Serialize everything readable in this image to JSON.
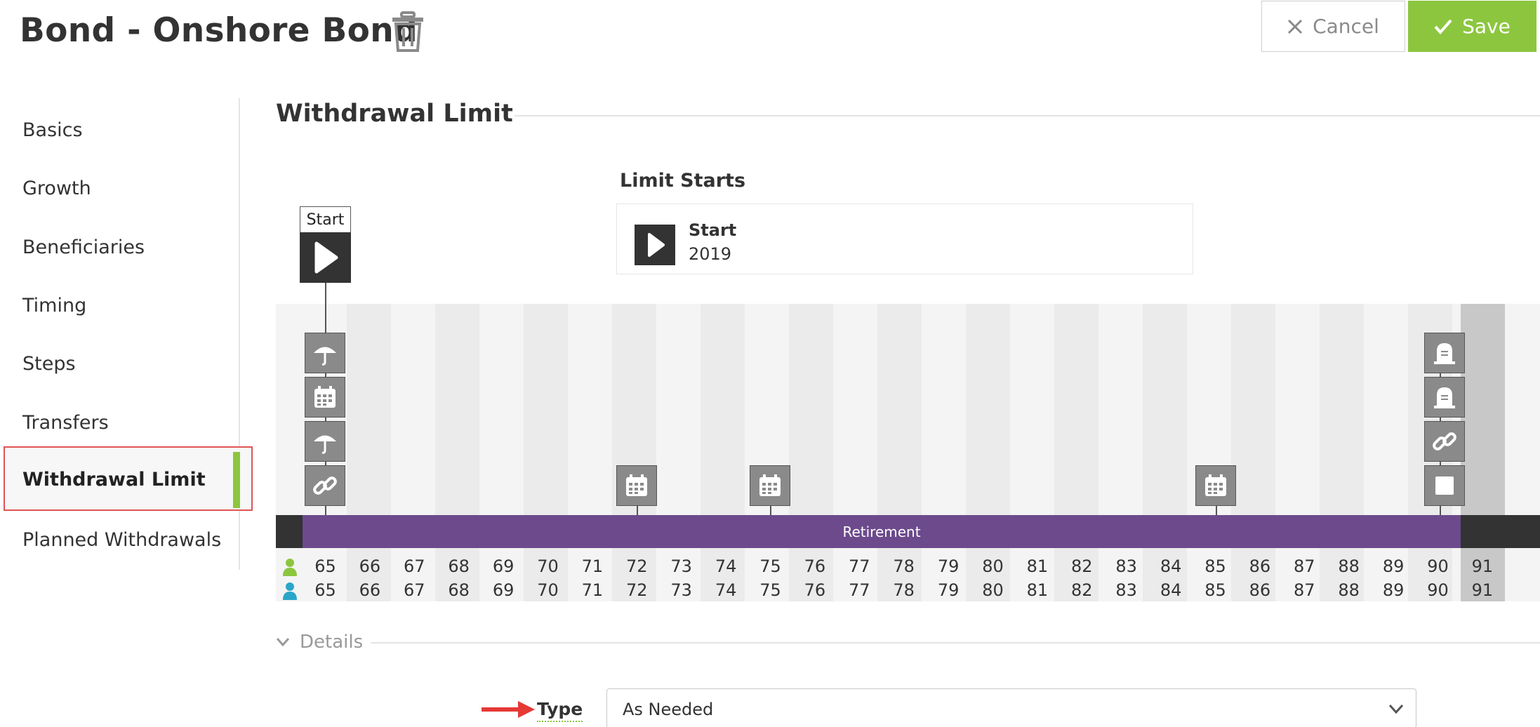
{
  "header": {
    "title": "Bond - Onshore Bond",
    "cancel_label": "Cancel",
    "save_label": "Save"
  },
  "sidebar": {
    "items": [
      {
        "label": "Basics"
      },
      {
        "label": "Growth"
      },
      {
        "label": "Beneficiaries"
      },
      {
        "label": "Timing"
      },
      {
        "label": "Steps"
      },
      {
        "label": "Transfers"
      },
      {
        "label": "Withdrawal Limit",
        "active": true
      },
      {
        "label": "Planned Withdrawals"
      }
    ]
  },
  "main": {
    "section_title": "Withdrawal Limit",
    "limit_starts": {
      "title": "Limit Starts",
      "event_name": "Start",
      "event_year": "2019"
    },
    "timeline": {
      "start_marker_label": "Start",
      "band_label": "Retirement",
      "ages_person1": [
        "65",
        "66",
        "67",
        "68",
        "69",
        "70",
        "71",
        "72",
        "73",
        "74",
        "75",
        "76",
        "77",
        "78",
        "79",
        "80",
        "81",
        "82",
        "83",
        "84",
        "85",
        "86",
        "87",
        "88",
        "89",
        "90",
        "91"
      ],
      "ages_person2": [
        "65",
        "66",
        "67",
        "68",
        "69",
        "70",
        "71",
        "72",
        "73",
        "74",
        "75",
        "76",
        "77",
        "78",
        "79",
        "80",
        "81",
        "82",
        "83",
        "84",
        "85",
        "86",
        "87",
        "88",
        "89",
        "90",
        "91"
      ],
      "person1_color": "#8cc63f",
      "person2_color": "#2aa6c9",
      "band_color": "#6c4a8c"
    },
    "details_label": "Details",
    "type_label": "Type",
    "type_value": "As Needed"
  },
  "colors": {
    "accent_green": "#8cc63f",
    "highlight_red": "#e05555"
  }
}
